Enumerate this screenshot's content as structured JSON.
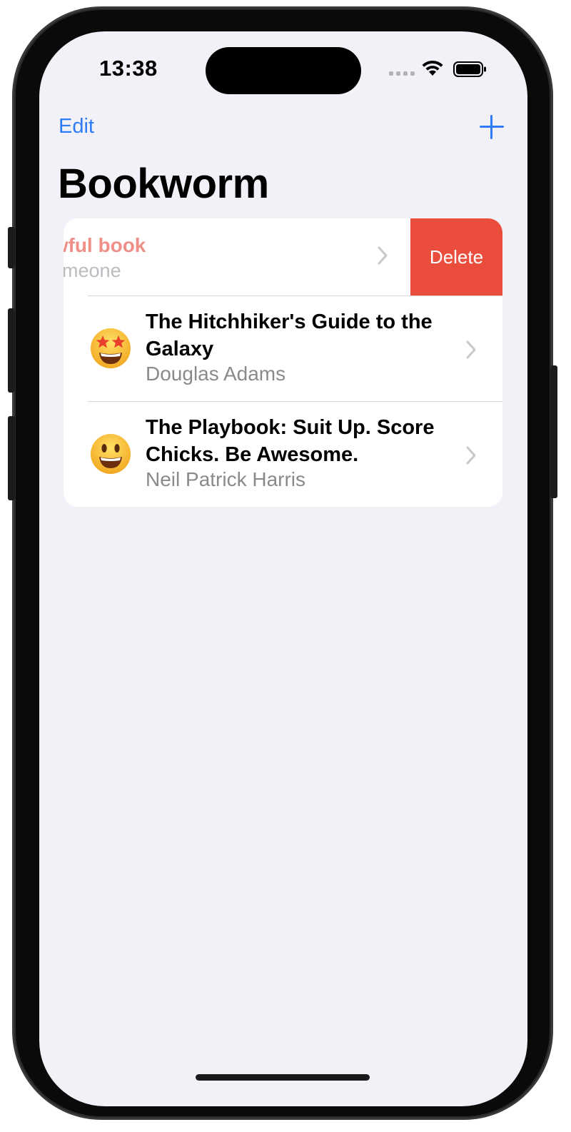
{
  "status_bar": {
    "time": "13:38"
  },
  "nav": {
    "edit_label": "Edit",
    "add_icon": "plus-icon"
  },
  "title": "Bookworm",
  "books": [
    {
      "title": "Awful book",
      "author": "Someone",
      "swiped": true,
      "action_label": "Delete"
    },
    {
      "title": "The Hitchhiker's Guide to the Galaxy",
      "author": "Douglas Adams",
      "rating_icon": "star-struck-face-emoji"
    },
    {
      "title": "The Playbook: Suit Up. Score Chicks. Be Awesome.",
      "author": "Neil Patrick Harris",
      "rating_icon": "smiling-face-emoji"
    }
  ],
  "colors": {
    "accent": "#2f7cf6",
    "destructive": "#eb4d3d",
    "background": "#f2f1f7"
  }
}
